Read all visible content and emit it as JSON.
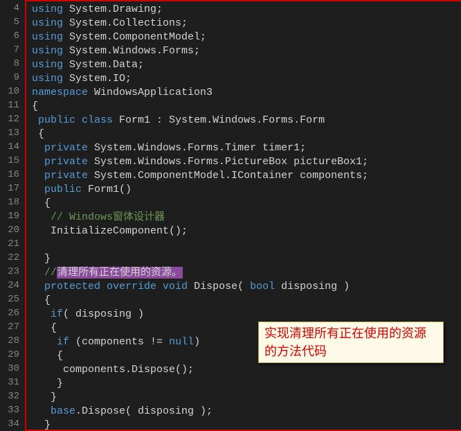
{
  "lineStart": 4,
  "lines": [
    {
      "segs": [
        {
          "t": "using ",
          "c": "kw"
        },
        {
          "t": "System.Drawing;",
          "c": "ident"
        }
      ]
    },
    {
      "segs": [
        {
          "t": "using ",
          "c": "kw"
        },
        {
          "t": "System.Collections;",
          "c": "ident"
        }
      ]
    },
    {
      "segs": [
        {
          "t": "using ",
          "c": "kw"
        },
        {
          "t": "System.ComponentModel;",
          "c": "ident"
        }
      ]
    },
    {
      "segs": [
        {
          "t": "using ",
          "c": "kw"
        },
        {
          "t": "System.Windows.Forms;",
          "c": "ident"
        }
      ]
    },
    {
      "segs": [
        {
          "t": "using ",
          "c": "kw"
        },
        {
          "t": "System.Data;",
          "c": "ident"
        }
      ]
    },
    {
      "segs": [
        {
          "t": "using ",
          "c": "kw"
        },
        {
          "t": "System.IO;",
          "c": "ident"
        }
      ]
    },
    {
      "segs": [
        {
          "t": "namespace ",
          "c": "kw"
        },
        {
          "t": "WindowsApplication3",
          "c": "ident"
        }
      ]
    },
    {
      "segs": [
        {
          "t": "{",
          "c": "brace"
        }
      ]
    },
    {
      "segs": [
        {
          "t": " ",
          "c": ""
        },
        {
          "t": "public class ",
          "c": "kw"
        },
        {
          "t": "Form1 : System.Windows.Forms.Form",
          "c": "ident"
        }
      ]
    },
    {
      "segs": [
        {
          "t": " {",
          "c": "brace"
        }
      ]
    },
    {
      "segs": [
        {
          "t": "  ",
          "c": ""
        },
        {
          "t": "private ",
          "c": "kw"
        },
        {
          "t": "System.Windows.Forms.Timer timer1;",
          "c": "ident"
        }
      ]
    },
    {
      "segs": [
        {
          "t": "  ",
          "c": ""
        },
        {
          "t": "private ",
          "c": "kw"
        },
        {
          "t": "System.Windows.Forms.PictureBox pictureBox1;",
          "c": "ident"
        }
      ]
    },
    {
      "segs": [
        {
          "t": "  ",
          "c": ""
        },
        {
          "t": "private ",
          "c": "kw"
        },
        {
          "t": "System.ComponentModel.IContainer components;",
          "c": "ident"
        }
      ]
    },
    {
      "segs": [
        {
          "t": "  ",
          "c": ""
        },
        {
          "t": "public ",
          "c": "kw"
        },
        {
          "t": "Form1()",
          "c": "ident"
        }
      ]
    },
    {
      "segs": [
        {
          "t": "  {",
          "c": "brace"
        }
      ]
    },
    {
      "segs": [
        {
          "t": "   ",
          "c": ""
        },
        {
          "t": "// Windows窗体设计器",
          "c": "cmt"
        }
      ]
    },
    {
      "segs": [
        {
          "t": "   InitializeComponent();",
          "c": "ident"
        }
      ]
    },
    {
      "segs": [
        {
          "t": "",
          "c": ""
        }
      ]
    },
    {
      "segs": [
        {
          "t": "  }",
          "c": "brace"
        }
      ]
    },
    {
      "segs": [
        {
          "t": "  ",
          "c": ""
        },
        {
          "t": "//",
          "c": "cmt"
        },
        {
          "t": "清理所有正在使用的资源。",
          "c": "cmt-hl"
        }
      ]
    },
    {
      "segs": [
        {
          "t": "  ",
          "c": ""
        },
        {
          "t": "protected override void ",
          "c": "kw"
        },
        {
          "t": "Dispose( ",
          "c": "ident"
        },
        {
          "t": "bool ",
          "c": "kw"
        },
        {
          "t": "disposing )",
          "c": "ident"
        }
      ]
    },
    {
      "segs": [
        {
          "t": "  {",
          "c": "brace"
        }
      ]
    },
    {
      "segs": [
        {
          "t": "   ",
          "c": ""
        },
        {
          "t": "if",
          "c": "kw"
        },
        {
          "t": "( disposing )",
          "c": "ident"
        }
      ]
    },
    {
      "segs": [
        {
          "t": "   {",
          "c": "brace"
        }
      ]
    },
    {
      "segs": [
        {
          "t": "    ",
          "c": ""
        },
        {
          "t": "if ",
          "c": "kw"
        },
        {
          "t": "(components != ",
          "c": "ident"
        },
        {
          "t": "null",
          "c": "kw"
        },
        {
          "t": ")",
          "c": "ident"
        }
      ]
    },
    {
      "segs": [
        {
          "t": "    {",
          "c": "brace"
        }
      ]
    },
    {
      "segs": [
        {
          "t": "     components.Dispose();",
          "c": "ident"
        }
      ]
    },
    {
      "segs": [
        {
          "t": "    }",
          "c": "brace"
        }
      ]
    },
    {
      "segs": [
        {
          "t": "   }",
          "c": "brace"
        }
      ]
    },
    {
      "segs": [
        {
          "t": "   ",
          "c": ""
        },
        {
          "t": "base",
          "c": "kw"
        },
        {
          "t": ".Dispose( disposing );",
          "c": "ident"
        }
      ]
    },
    {
      "segs": [
        {
          "t": "  }",
          "c": "brace"
        }
      ]
    }
  ],
  "annotation": "实现清理所有正在使用的资源的方法代码"
}
